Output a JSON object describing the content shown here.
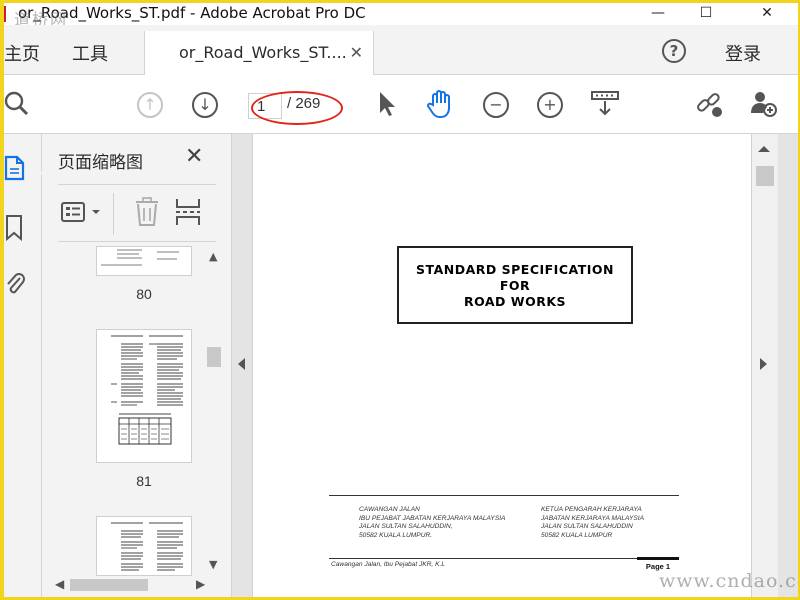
{
  "window": {
    "title": "or_Road_Works_ST.pdf - Adobe Acrobat Pro DC",
    "minimize_glyph": "—",
    "maximize_glyph": "☐",
    "close_glyph": "✕",
    "watermark_top": "道桥网"
  },
  "menu": {
    "home": "主页",
    "tools": "工具",
    "tab_label": "or_Road_Works_ST....",
    "tab_close": "✕",
    "help": "?",
    "login": "登录"
  },
  "toolbar": {
    "page_current": "1",
    "page_total": "/ 269"
  },
  "thumbnails": {
    "panel_title": "页面缩略图",
    "close_glyph": "✕",
    "pages": [
      "80",
      "81"
    ]
  },
  "document": {
    "title_lines": [
      "STANDARD SPECIFICATION",
      "FOR",
      "ROAD WORKS"
    ],
    "address_left": [
      "CAWANGAN JALAN",
      "IBU PEJABAT JABATAN KERJARAYA MALAYSIA",
      "JALAN SULTAN SALAHUDDIN,",
      "50582 KUALA LUMPUR."
    ],
    "address_right": [
      "KETUA PENGARAH KERJARAYA",
      "JABATAN KERJARAYA MALAYSIA",
      "JALAN SULTAN SALAHUDDIN",
      "50582 KUALA LUMPUR"
    ],
    "footer_left": "Cawangan Jalan, Ibu Pejabat JKR, K.L",
    "footer_right": "Page 1"
  },
  "watermark_bottom": "www.cndao.com",
  "colors": {
    "annotation_oval": "#e1261c",
    "active_icon": "#1473e6",
    "border": "#f2d41e"
  }
}
